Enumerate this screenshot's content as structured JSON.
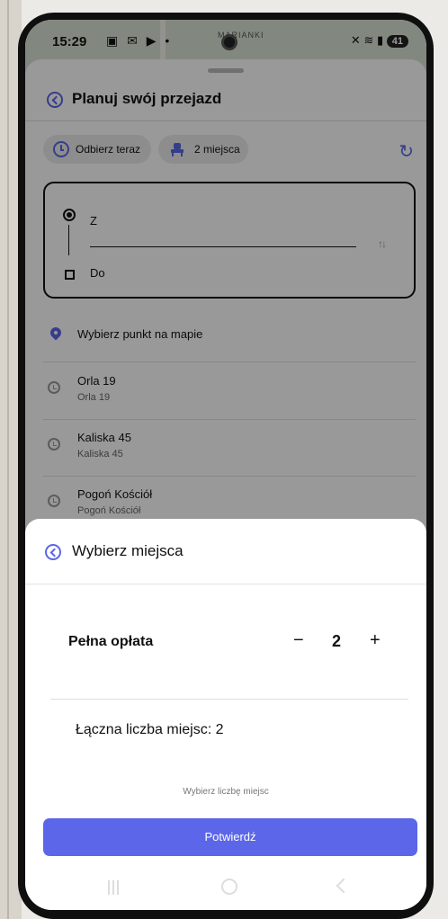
{
  "status_bar": {
    "time": "15:29",
    "battery": "41"
  },
  "map": {
    "label": "MARIANKI"
  },
  "header": {
    "title": "Planuj swój przejazd"
  },
  "chips": {
    "pickup": "Odbierz teraz",
    "seats": "2 miejsca"
  },
  "route": {
    "from_label": "Z",
    "to_label": "Do"
  },
  "pick_on_map": "Wybierz punkt na mapie",
  "history": [
    {
      "main": "Orla 19",
      "sub": "Orla 19"
    },
    {
      "main": "Kaliska 45",
      "sub": "Kaliska 45"
    },
    {
      "main": "Pogoń Kościół",
      "sub": "Pogoń Kościół"
    }
  ],
  "seat_modal": {
    "title": "Wybierz miejsca",
    "fare_label": "Pełna opłata",
    "minus": "−",
    "count": "2",
    "plus": "+",
    "total": "Łączna liczba miejsc: 2",
    "hint": "Wybierz liczbę miejsc",
    "confirm": "Potwierdź"
  },
  "colors": {
    "accent": "#5b67e8"
  }
}
